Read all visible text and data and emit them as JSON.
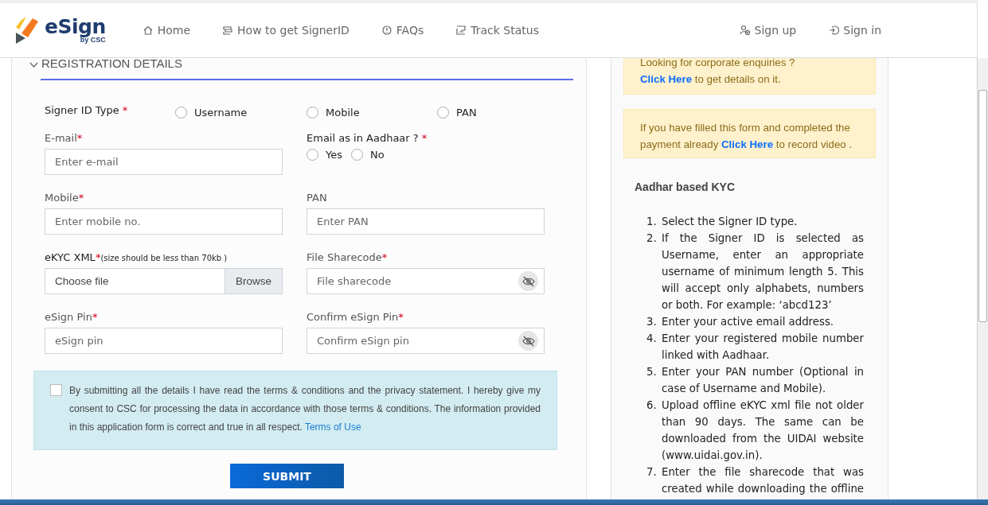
{
  "header": {
    "logo": {
      "name": "eSign",
      "tagline": "by CSC"
    },
    "nav": [
      {
        "label": "Home"
      },
      {
        "label": "How to get SignerID"
      },
      {
        "label": "FAQs"
      },
      {
        "label": "Track Status"
      }
    ],
    "account": [
      {
        "label": "Sign up"
      },
      {
        "label": "Sign in"
      }
    ]
  },
  "form": {
    "section_title": "REGISTRATION DETAILS",
    "expanded": true,
    "signer_id_type": {
      "label": "Signer ID Type",
      "required_mark": "*",
      "options": [
        {
          "label": "Username",
          "selected": false
        },
        {
          "label": "Mobile",
          "selected": false
        },
        {
          "label": "PAN",
          "selected": false
        }
      ]
    },
    "fields": [
      {
        "kind": "text",
        "label": "E-mail",
        "required_mark": "*",
        "placeholder": "Enter e-mail"
      },
      {
        "kind": "radio",
        "label": "Email as in Aadhaar ?",
        "required_mark": "*",
        "options": [
          {
            "label": "Yes",
            "selected": false
          },
          {
            "label": "No",
            "selected": false
          }
        ]
      },
      {
        "kind": "text",
        "label": "Mobile",
        "required_mark": "*",
        "placeholder": "Enter mobile no."
      },
      {
        "kind": "text",
        "label": "PAN",
        "placeholder": "Enter PAN"
      },
      {
        "kind": "file",
        "label": "eKYC XML",
        "required_mark": "*",
        "note": "(size should be less than 70kb )",
        "placeholder": "Choose file",
        "button": "Browse"
      },
      {
        "kind": "password",
        "label": "File Sharecode",
        "required_mark": "*",
        "placeholder": "File sharecode"
      },
      {
        "kind": "text",
        "label": "eSign Pin",
        "required_mark": "*",
        "placeholder": "eSign pin"
      },
      {
        "kind": "password",
        "label": "Confirm eSign Pin",
        "required_mark": "*",
        "placeholder": "Confirm eSign pin"
      }
    ],
    "consent": {
      "checked": false,
      "text": "By submitting all the details I have read the terms & conditions and the privacy statement. I hereby give my consent to CSC for processing the data in accordance with those terms & conditions. The information provided in this application form is correct and true in all respect.",
      "link": "Terms of Use"
    },
    "submit": "SUBMIT"
  },
  "sidebar": {
    "notices": [
      {
        "lead": "Looking for corporate enquiries ?",
        "link": "Click Here",
        "after": "to get details on it."
      },
      {
        "before": "If you have filled this form and completed the payment already",
        "link": "Click Here",
        "after": "to record video ."
      }
    ],
    "kyc_title": "Aadhar based KYC",
    "steps": [
      {
        "number": "1.",
        "text": "Select the Signer ID type."
      },
      {
        "number": "2.",
        "text": "If the Signer ID is selected as Username, enter an appropriate username of minimum length 5. This will accept only alphabets, numbers or both. For example: ‘abcd123’"
      },
      {
        "number": "3.",
        "text": "Enter your active email address."
      },
      {
        "number": "4.",
        "text": "Enter your registered mobile number linked with Aadhaar."
      },
      {
        "number": "5.",
        "text": "Enter your PAN number (Optional in case of Username and Mobile)."
      },
      {
        "number": "6.",
        "text": "Upload offline eKYC xml file not older than 90 days. The same can be downloaded from the UIDAI website (www.uidai.gov.in)."
      },
      {
        "number": "7.",
        "text": "Enter the file sharecode that was created while downloading the offline"
      }
    ]
  }
}
